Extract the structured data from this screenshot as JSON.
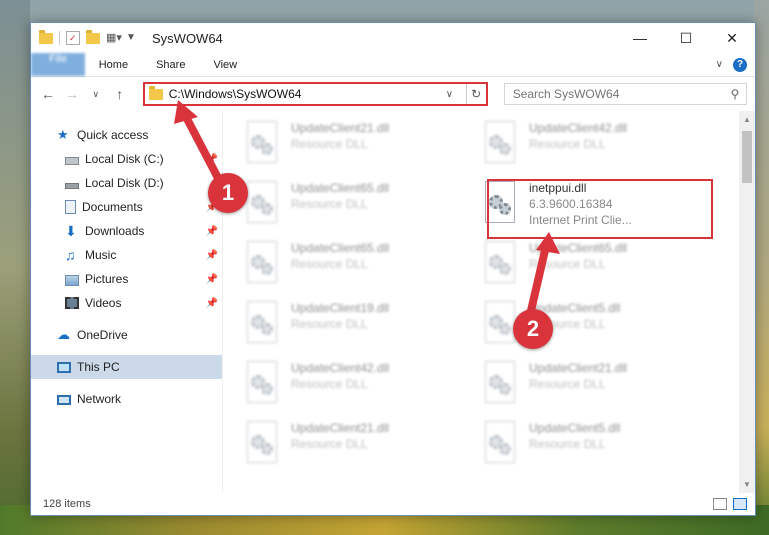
{
  "window": {
    "title": "SysWOW64"
  },
  "ribbon": {
    "tabs": [
      {
        "label": "File"
      },
      {
        "label": "Home"
      },
      {
        "label": "Share"
      },
      {
        "label": "View"
      }
    ]
  },
  "address": {
    "path": "C:\\Windows\\SysWOW64"
  },
  "search": {
    "placeholder": "Search SysWOW64"
  },
  "sidebar": {
    "items": [
      {
        "label": "Quick access"
      },
      {
        "label": "Local Disk (C:)"
      },
      {
        "label": "Local Disk (D:)"
      },
      {
        "label": "Documents"
      },
      {
        "label": "Downloads"
      },
      {
        "label": "Music"
      },
      {
        "label": "Pictures"
      },
      {
        "label": "Videos"
      },
      {
        "label": "OneDrive"
      },
      {
        "label": "This PC"
      },
      {
        "label": "Network"
      }
    ]
  },
  "files": [
    {
      "name": "UpdateClient21.dll",
      "line1": "Resource DLL",
      "line2": ""
    },
    {
      "name": "UpdateClient42.dll",
      "line1": "Resource DLL",
      "line2": ""
    },
    {
      "name": "UpdateClient65.dll",
      "line1": "Resource DLL",
      "line2": ""
    },
    {
      "name": "inetppui.dll",
      "line1": "6.3.9600.16384",
      "line2": "Internet Print Clie..."
    },
    {
      "name": "UpdateClient65.dll",
      "line1": "Resource DLL",
      "line2": ""
    },
    {
      "name": "UpdateClient65.dll",
      "line1": "Resource DLL",
      "line2": ""
    },
    {
      "name": "UpdateClient19.dll",
      "line1": "Resource DLL",
      "line2": ""
    },
    {
      "name": "UpdateClient5.dll",
      "line1": "Resource DLL",
      "line2": ""
    },
    {
      "name": "UpdateClient42.dll",
      "line1": "Resource DLL",
      "line2": ""
    },
    {
      "name": "UpdateClient21.dll",
      "line1": "Resource DLL",
      "line2": ""
    },
    {
      "name": "UpdateClient21.dll",
      "line1": "Resource DLL",
      "line2": ""
    },
    {
      "name": "UpdateClient5.dll",
      "line1": "Resource DLL",
      "line2": ""
    }
  ],
  "status": {
    "count": "128 items"
  },
  "annotations": {
    "badge1": "1",
    "badge2": "2",
    "color": "#d9343c"
  }
}
